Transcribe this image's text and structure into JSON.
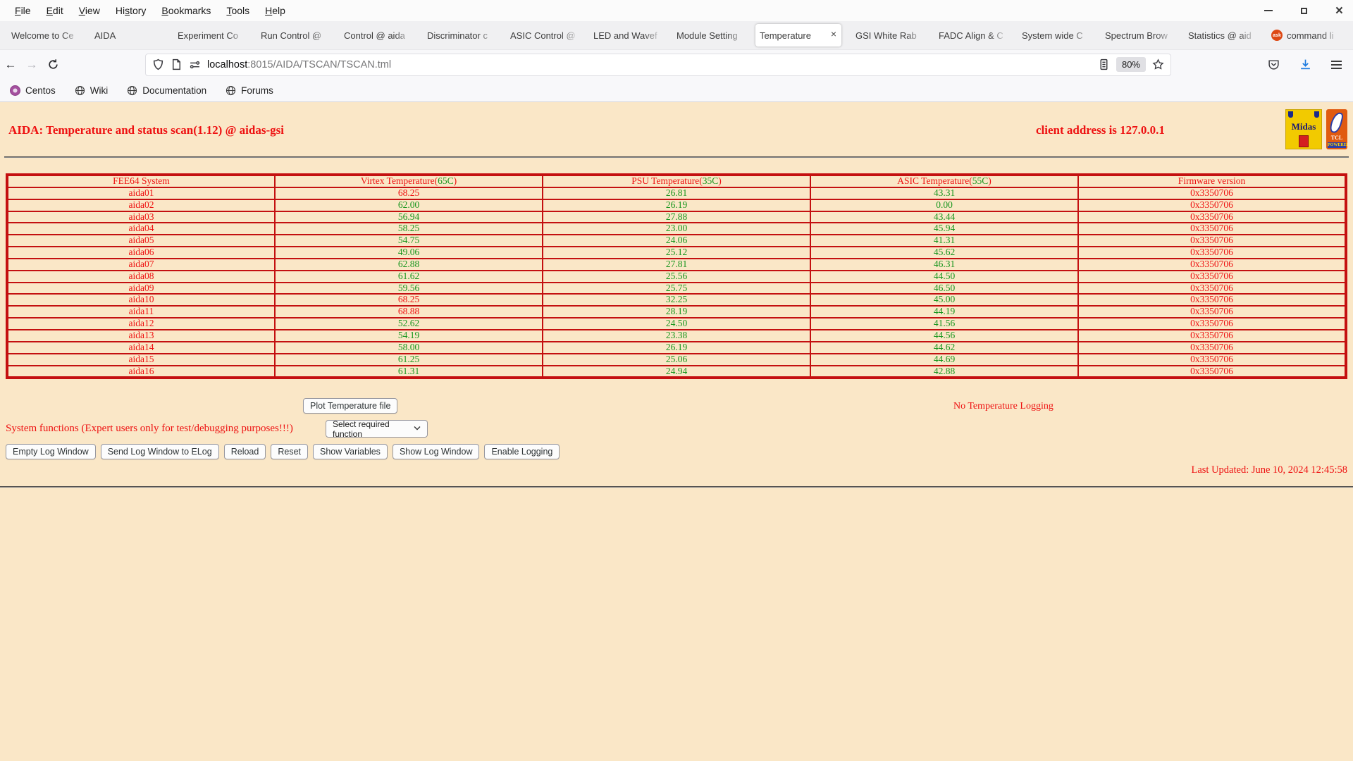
{
  "menu_bar": {
    "items": [
      {
        "label": "File",
        "mnemonic": "F"
      },
      {
        "label": "Edit",
        "mnemonic": "E"
      },
      {
        "label": "View",
        "mnemonic": "V"
      },
      {
        "label": "History",
        "mnemonic": "s"
      },
      {
        "label": "Bookmarks",
        "mnemonic": "B"
      },
      {
        "label": "Tools",
        "mnemonic": "T"
      },
      {
        "label": "Help",
        "mnemonic": "H"
      }
    ]
  },
  "tab_bar": {
    "close_glyph": "×",
    "new_tab_glyph": "+",
    "ask_icon_text": "ask",
    "tabs": [
      {
        "label": "Welcome to Ce"
      },
      {
        "label": "AIDA"
      },
      {
        "label": "Experiment Co"
      },
      {
        "label": "Run Control @"
      },
      {
        "label": "Control @ aida"
      },
      {
        "label": "Discriminator c"
      },
      {
        "label": "ASIC Control @"
      },
      {
        "label": "LED and Wavef"
      },
      {
        "label": "Module Setting"
      },
      {
        "label": "Temperature",
        "active": true
      },
      {
        "label": "GSI White Rab"
      },
      {
        "label": "FADC Align & C"
      },
      {
        "label": "System wide C"
      },
      {
        "label": "Spectrum Brow"
      },
      {
        "label": "Statistics @ aid"
      },
      {
        "label": "command li",
        "icon": "ask"
      }
    ]
  },
  "toolbar": {
    "url_host": "localhost",
    "url_rest": ":8015/AIDA/TSCAN/TSCAN.tml",
    "zoom_level": "80%"
  },
  "bookmarks": [
    {
      "label": "Centos",
      "icon": "centos"
    },
    {
      "label": "Wiki",
      "icon": "globe"
    },
    {
      "label": "Documentation",
      "icon": "globe"
    },
    {
      "label": "Forums",
      "icon": "globe"
    }
  ],
  "page": {
    "title": "AIDA: Temperature and status scan(1.12) @ aidas-gsi",
    "client_address": "client address is 127.0.0.1",
    "logos": {
      "midas_text": "Midas",
      "tcl_text": "TCL",
      "tcl_band": "POWERED"
    },
    "table": {
      "columns": [
        {
          "label": "FEE64 System"
        },
        {
          "label": "Virtex Temperature",
          "threshold": "65C"
        },
        {
          "label": "PSU Temperature",
          "threshold": "35C"
        },
        {
          "label": "ASIC Temperature",
          "threshold": "55C"
        },
        {
          "label": "Firmware version"
        }
      ],
      "rows": [
        {
          "name": "aida01",
          "virtex": "68.25",
          "virtex_alarm": true,
          "psu": "26.81",
          "asic": "43.31",
          "firmware": "0x3350706"
        },
        {
          "name": "aida02",
          "virtex": "62.00",
          "virtex_alarm": false,
          "psu": "26.19",
          "asic": "0.00",
          "firmware": "0x3350706"
        },
        {
          "name": "aida03",
          "virtex": "56.94",
          "virtex_alarm": false,
          "psu": "27.88",
          "asic": "43.44",
          "firmware": "0x3350706"
        },
        {
          "name": "aida04",
          "virtex": "58.25",
          "virtex_alarm": false,
          "psu": "23.00",
          "asic": "45.94",
          "firmware": "0x3350706"
        },
        {
          "name": "aida05",
          "virtex": "54.75",
          "virtex_alarm": false,
          "psu": "24.06",
          "asic": "41.31",
          "firmware": "0x3350706"
        },
        {
          "name": "aida06",
          "virtex": "49.06",
          "virtex_alarm": false,
          "psu": "25.12",
          "asic": "45.62",
          "firmware": "0x3350706"
        },
        {
          "name": "aida07",
          "virtex": "62.88",
          "virtex_alarm": false,
          "psu": "27.81",
          "asic": "46.31",
          "firmware": "0x3350706"
        },
        {
          "name": "aida08",
          "virtex": "61.62",
          "virtex_alarm": false,
          "psu": "25.56",
          "asic": "44.50",
          "firmware": "0x3350706"
        },
        {
          "name": "aida09",
          "virtex": "59.56",
          "virtex_alarm": false,
          "psu": "25.75",
          "asic": "46.50",
          "firmware": "0x3350706"
        },
        {
          "name": "aida10",
          "virtex": "68.25",
          "virtex_alarm": true,
          "psu": "32.25",
          "asic": "45.00",
          "firmware": "0x3350706"
        },
        {
          "name": "aida11",
          "virtex": "68.88",
          "virtex_alarm": true,
          "psu": "28.19",
          "asic": "44.19",
          "firmware": "0x3350706"
        },
        {
          "name": "aida12",
          "virtex": "52.62",
          "virtex_alarm": false,
          "psu": "24.50",
          "asic": "41.56",
          "firmware": "0x3350706"
        },
        {
          "name": "aida13",
          "virtex": "54.19",
          "virtex_alarm": false,
          "psu": "23.38",
          "asic": "44.56",
          "firmware": "0x3350706"
        },
        {
          "name": "aida14",
          "virtex": "58.00",
          "virtex_alarm": false,
          "psu": "26.19",
          "asic": "44.62",
          "firmware": "0x3350706"
        },
        {
          "name": "aida15",
          "virtex": "61.25",
          "virtex_alarm": false,
          "psu": "25.06",
          "asic": "44.69",
          "firmware": "0x3350706"
        },
        {
          "name": "aida16",
          "virtex": "61.31",
          "virtex_alarm": false,
          "psu": "24.94",
          "asic": "42.88",
          "firmware": "0x3350706"
        }
      ]
    },
    "plot_button": "Plot Temperature file",
    "logging_status": "No Temperature Logging",
    "system_functions_label": "System functions (Expert users only for test/debugging purposes!!!)",
    "select_value": "Select required function",
    "action_buttons": [
      "Empty Log Window",
      "Send Log Window to ELog",
      "Reload",
      "Reset",
      "Show Variables",
      "Show Log Window",
      "Enable Logging"
    ],
    "last_updated": "Last Updated: June 10, 2024 12:45:58"
  },
  "colors": {
    "page_background": "#fae7c7",
    "alert_red": "#ee1111",
    "ok_green": "#18961e",
    "table_border_red": "#c41010"
  }
}
